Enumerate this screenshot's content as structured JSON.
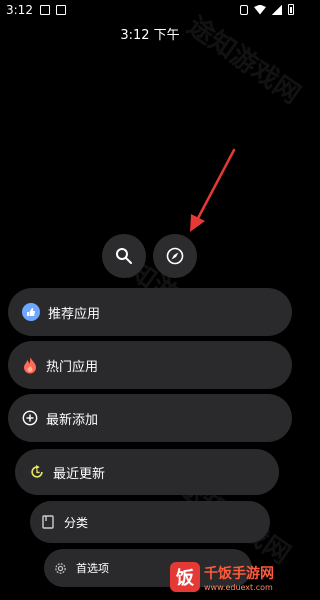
{
  "status_bar": {
    "time": "3:12"
  },
  "clock": "3:12 下午",
  "buttons": {
    "search": "search-icon",
    "explore": "compass-icon"
  },
  "menu": [
    {
      "label": "推荐应用",
      "icon": "thumbs-up-icon",
      "color": "#6ea8fe"
    },
    {
      "label": "热门应用",
      "icon": "flame-icon",
      "color": "#ff6b57"
    },
    {
      "label": "最新添加",
      "icon": "plus-circle-icon",
      "color": "#ffffff"
    },
    {
      "label": "最近更新",
      "icon": "refresh-icon",
      "color": "#e8e66a"
    },
    {
      "label": "分类",
      "icon": "bookmark-icon",
      "color": "#cccccc"
    },
    {
      "label": "首选项",
      "icon": "gear-icon",
      "color": "#cccccc"
    }
  ],
  "watermark": {
    "title": "千饭手游网",
    "url": "www.eduext.com",
    "badge": "饭"
  },
  "overlay_watermark": "途知游戏网",
  "arrow_color": "#e53935"
}
